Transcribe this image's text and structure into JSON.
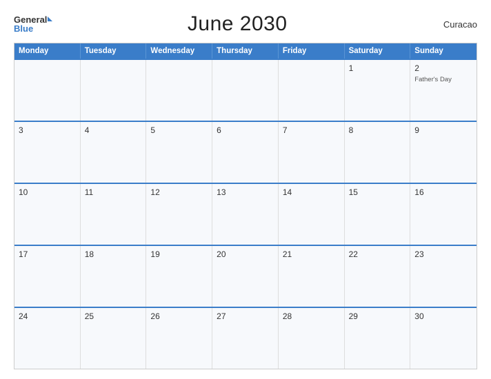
{
  "header": {
    "title": "June 2030",
    "region": "Curacao",
    "logo_general": "General",
    "logo_blue": "Blue"
  },
  "days_of_week": [
    "Monday",
    "Tuesday",
    "Wednesday",
    "Thursday",
    "Friday",
    "Saturday",
    "Sunday"
  ],
  "weeks": [
    [
      {
        "day": "",
        "events": []
      },
      {
        "day": "",
        "events": []
      },
      {
        "day": "",
        "events": []
      },
      {
        "day": "",
        "events": []
      },
      {
        "day": "",
        "events": []
      },
      {
        "day": "1",
        "events": []
      },
      {
        "day": "2",
        "events": [
          "Father's Day"
        ]
      }
    ],
    [
      {
        "day": "3",
        "events": []
      },
      {
        "day": "4",
        "events": []
      },
      {
        "day": "5",
        "events": []
      },
      {
        "day": "6",
        "events": []
      },
      {
        "day": "7",
        "events": []
      },
      {
        "day": "8",
        "events": []
      },
      {
        "day": "9",
        "events": []
      }
    ],
    [
      {
        "day": "10",
        "events": []
      },
      {
        "day": "11",
        "events": []
      },
      {
        "day": "12",
        "events": []
      },
      {
        "day": "13",
        "events": []
      },
      {
        "day": "14",
        "events": []
      },
      {
        "day": "15",
        "events": []
      },
      {
        "day": "16",
        "events": []
      }
    ],
    [
      {
        "day": "17",
        "events": []
      },
      {
        "day": "18",
        "events": []
      },
      {
        "day": "19",
        "events": []
      },
      {
        "day": "20",
        "events": []
      },
      {
        "day": "21",
        "events": []
      },
      {
        "day": "22",
        "events": []
      },
      {
        "day": "23",
        "events": []
      }
    ],
    [
      {
        "day": "24",
        "events": []
      },
      {
        "day": "25",
        "events": []
      },
      {
        "day": "26",
        "events": []
      },
      {
        "day": "27",
        "events": []
      },
      {
        "day": "28",
        "events": []
      },
      {
        "day": "29",
        "events": []
      },
      {
        "day": "30",
        "events": []
      }
    ]
  ],
  "colors": {
    "header_bg": "#3a7dc9",
    "accent": "#3a7dc9",
    "cell_bg": "#f7f9fc"
  }
}
